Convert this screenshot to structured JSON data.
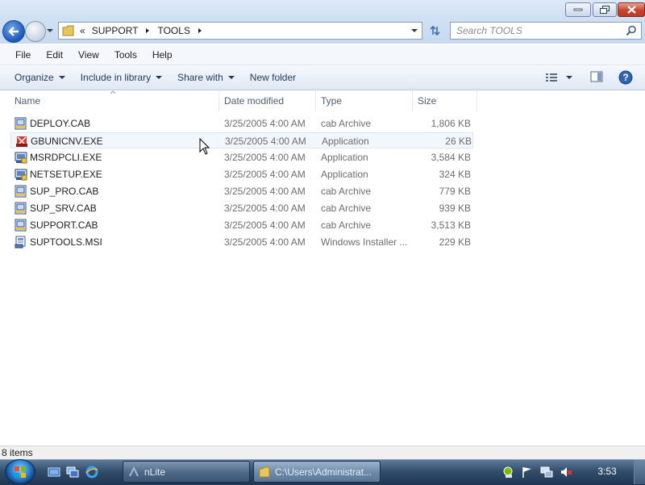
{
  "window": {
    "address": {
      "overflow": "«",
      "crumbs": [
        "SUPPORT",
        "TOOLS"
      ]
    },
    "search_placeholder": "Search TOOLS"
  },
  "menu": [
    "File",
    "Edit",
    "View",
    "Tools",
    "Help"
  ],
  "commands": {
    "organize": "Organize",
    "include": "Include in library",
    "share": "Share with",
    "new_folder": "New folder"
  },
  "columns": {
    "name": "Name",
    "date": "Date modified",
    "type": "Type",
    "size": "Size"
  },
  "files": [
    {
      "name": "DEPLOY.CAB",
      "date": "3/25/2005 4:00 AM",
      "type": "cab Archive",
      "size": "1,806 KB",
      "icon": "cab-file-icon"
    },
    {
      "name": "GBUNICNV.EXE",
      "date": "3/25/2005 4:00 AM",
      "type": "Application",
      "size": "26 KB",
      "icon": "exe-red-icon"
    },
    {
      "name": "MSRDPCLI.EXE",
      "date": "3/25/2005 4:00 AM",
      "type": "Application",
      "size": "3,584 KB",
      "icon": "setup-exe-icon"
    },
    {
      "name": "NETSETUP.EXE",
      "date": "3/25/2005 4:00 AM",
      "type": "Application",
      "size": "324 KB",
      "icon": "setup-exe-icon"
    },
    {
      "name": "SUP_PRO.CAB",
      "date": "3/25/2005 4:00 AM",
      "type": "cab Archive",
      "size": "779 KB",
      "icon": "cab-file-icon"
    },
    {
      "name": "SUP_SRV.CAB",
      "date": "3/25/2005 4:00 AM",
      "type": "cab Archive",
      "size": "939 KB",
      "icon": "cab-file-icon"
    },
    {
      "name": "SUPPORT.CAB",
      "date": "3/25/2005 4:00 AM",
      "type": "cab Archive",
      "size": "3,513 KB",
      "icon": "cab-file-icon"
    },
    {
      "name": "SUPTOOLS.MSI",
      "date": "3/25/2005 4:00 AM",
      "type": "Windows Installer ...",
      "size": "229 KB",
      "icon": "msi-file-icon"
    }
  ],
  "status": "8 items",
  "taskbar": {
    "tasks": [
      {
        "label": "nLite"
      },
      {
        "label": "C:\\Users\\Administrat..."
      }
    ],
    "clock": "3:53"
  },
  "colors": {
    "accent": "#1c56b8",
    "hover_row": "#f1f7fd",
    "taskbar": "#324d6a"
  }
}
